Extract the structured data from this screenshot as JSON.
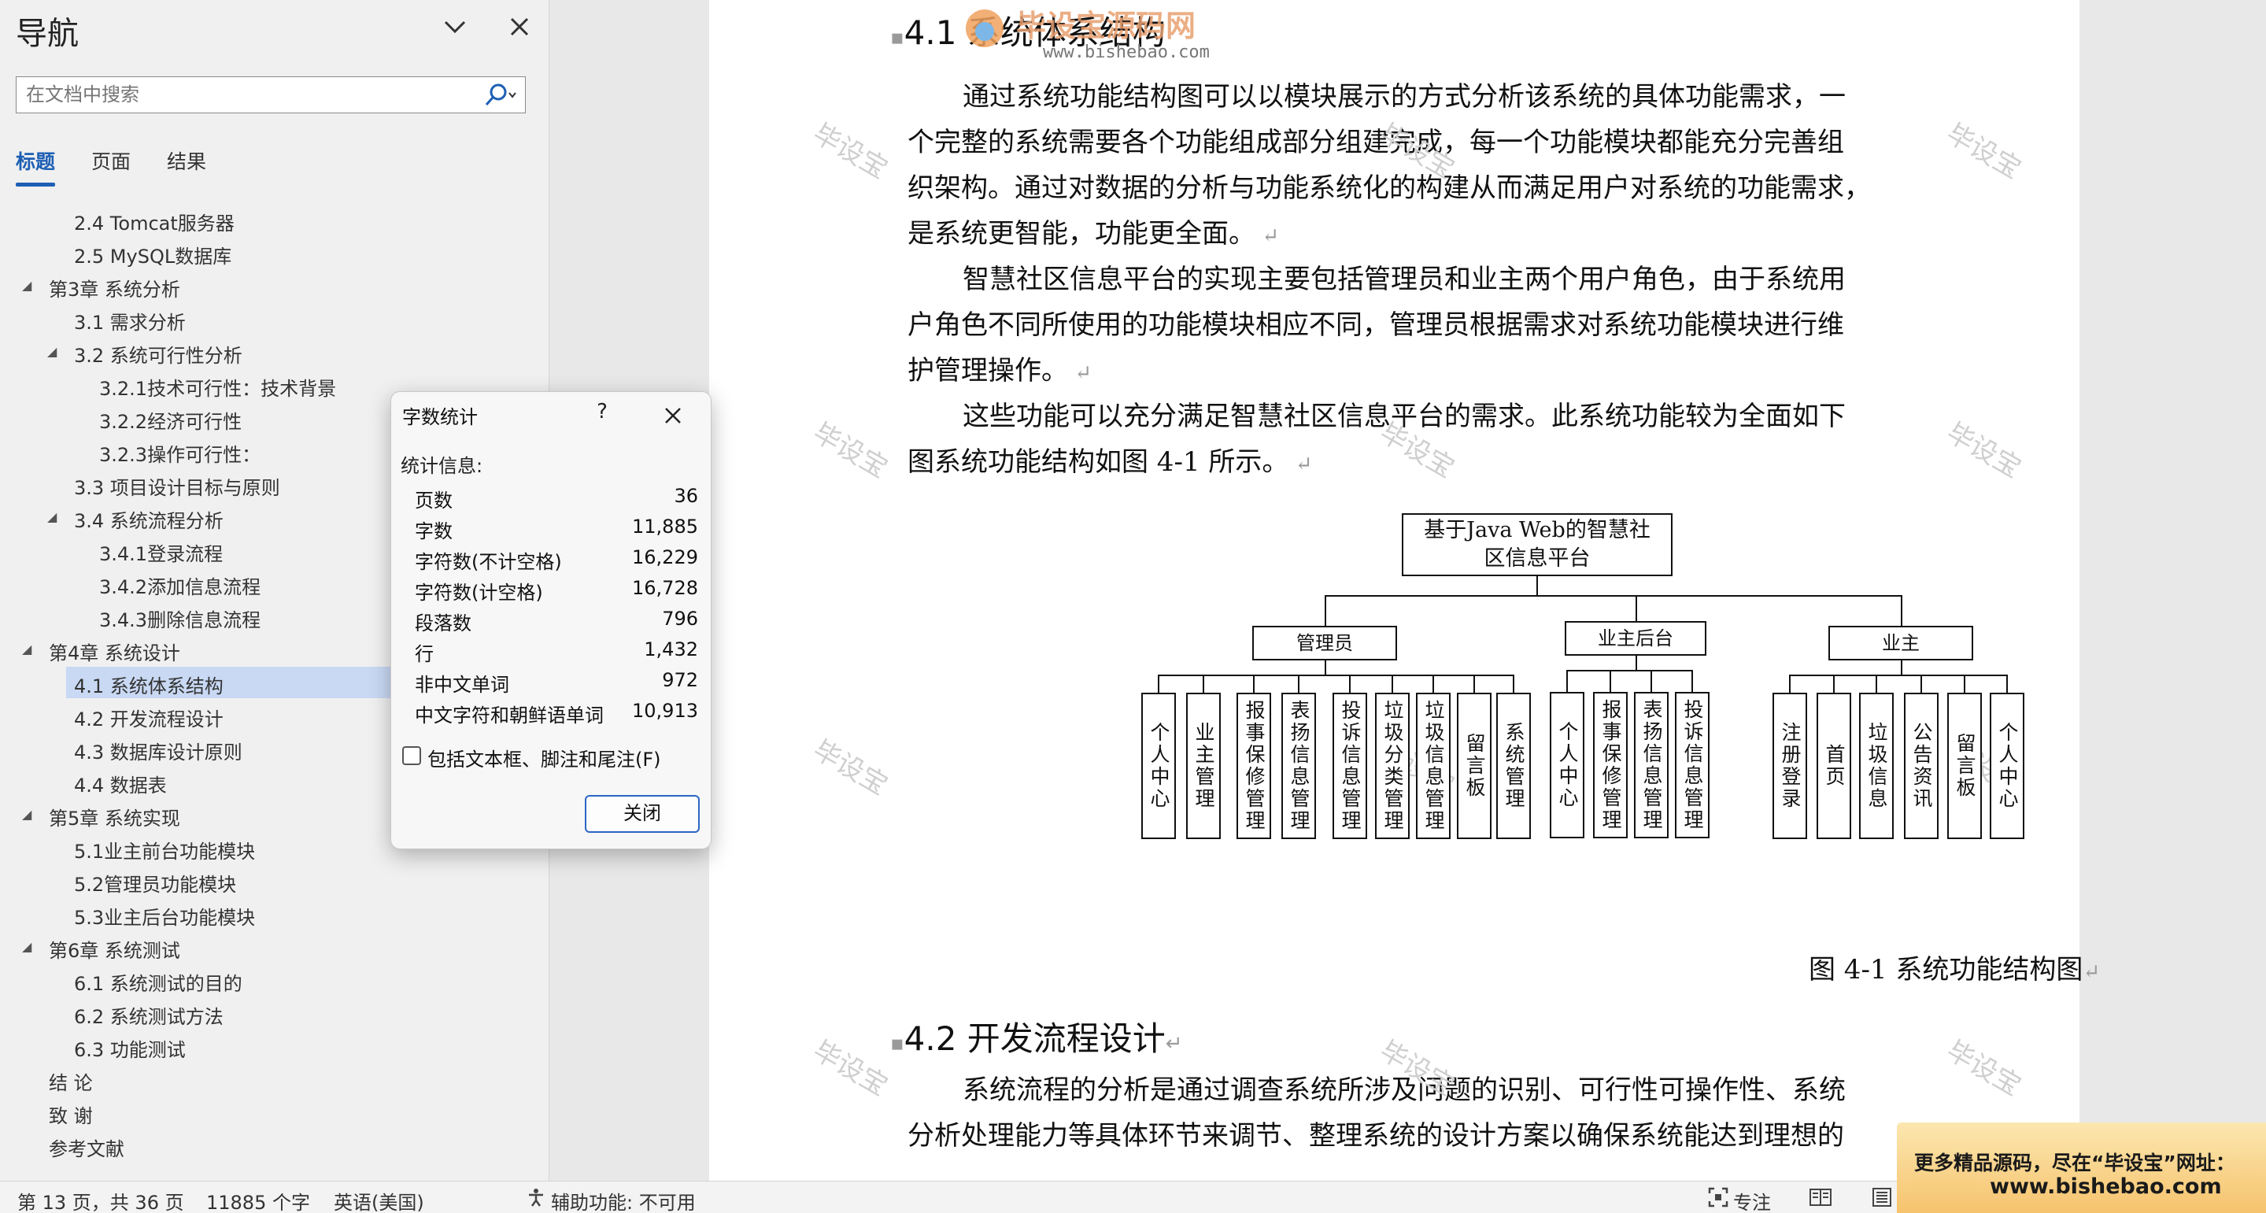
{
  "nav": {
    "title": "导航",
    "search_placeholder": "在文档中搜索",
    "tabs": [
      "标题",
      "页面",
      "结果"
    ],
    "items": [
      {
        "label": "2.4 Tomcat服务器",
        "level": 2,
        "toggle": false,
        "selected": false
      },
      {
        "label": "2.5 MySQL数据库",
        "level": 2,
        "toggle": false,
        "selected": false
      },
      {
        "label": "第3章 系统分析",
        "level": 1,
        "toggle": true,
        "selected": false
      },
      {
        "label": "3.1 需求分析",
        "level": 2,
        "toggle": false,
        "selected": false
      },
      {
        "label": "3.2 系统可行性分析",
        "level": 2,
        "toggle": true,
        "selected": false
      },
      {
        "label": "3.2.1技术可行性：技术背景",
        "level": 3,
        "toggle": false,
        "selected": false
      },
      {
        "label": "3.2.2经济可行性",
        "level": 3,
        "toggle": false,
        "selected": false
      },
      {
        "label": "3.2.3操作可行性：",
        "level": 3,
        "toggle": false,
        "selected": false
      },
      {
        "label": "3.3 项目设计目标与原则",
        "level": 2,
        "toggle": false,
        "selected": false
      },
      {
        "label": "3.4 系统流程分析",
        "level": 2,
        "toggle": true,
        "selected": false
      },
      {
        "label": "3.4.1登录流程",
        "level": 3,
        "toggle": false,
        "selected": false
      },
      {
        "label": "3.4.2添加信息流程",
        "level": 3,
        "toggle": false,
        "selected": false
      },
      {
        "label": "3.4.3删除信息流程",
        "level": 3,
        "toggle": false,
        "selected": false
      },
      {
        "label": "第4章 系统设计",
        "level": 1,
        "toggle": true,
        "selected": false
      },
      {
        "label": "4.1 系统体系结构",
        "level": 2,
        "toggle": false,
        "selected": true
      },
      {
        "label": "4.2 开发流程设计",
        "level": 2,
        "toggle": false,
        "selected": false
      },
      {
        "label": "4.3 数据库设计原则",
        "level": 2,
        "toggle": false,
        "selected": false
      },
      {
        "label": "4.4 数据表",
        "level": 2,
        "toggle": false,
        "selected": false
      },
      {
        "label": "第5章 系统实现",
        "level": 1,
        "toggle": true,
        "selected": false
      },
      {
        "label": "5.1业主前台功能模块",
        "level": 2,
        "toggle": false,
        "selected": false
      },
      {
        "label": "5.2管理员功能模块",
        "level": 2,
        "toggle": false,
        "selected": false
      },
      {
        "label": "5.3业主后台功能模块",
        "level": 2,
        "toggle": false,
        "selected": false
      },
      {
        "label": "第6章 系统测试",
        "level": 1,
        "toggle": true,
        "selected": false
      },
      {
        "label": "6.1 系统测试的目的",
        "level": 2,
        "toggle": false,
        "selected": false
      },
      {
        "label": "6.2 系统测试方法",
        "level": 2,
        "toggle": false,
        "selected": false
      },
      {
        "label": "6.3 功能测试",
        "level": 2,
        "toggle": false,
        "selected": false
      },
      {
        "label": "结 论",
        "level": 1,
        "toggle": false,
        "selected": false
      },
      {
        "label": "致 谢",
        "level": 1,
        "toggle": false,
        "selected": false
      },
      {
        "label": "参考文献",
        "level": 1,
        "toggle": false,
        "selected": false
      }
    ]
  },
  "document": {
    "heading_41": "4.1  系统体系结构",
    "para1": [
      "通过系统功能结构图可以以模块展示的方式分析该系统的具体功能需求，一",
      "个完整的系统需要各个功能组成部分组建完成，每一个功能模块都能充分完善组",
      "织架构。通过对数据的分析与功能系统化的构建从而满足用户对系统的功能需求，",
      "是系统更智能，功能更全面。"
    ],
    "para2": [
      "智慧社区信息平台的实现主要包括管理员和业主两个用户角色，由于系统用",
      "户角色不同所使用的功能模块相应不同，管理员根据需求对系统功能模块进行维",
      "护管理操作。"
    ],
    "para3": [
      "这些功能可以充分满足智慧社区信息平台的需求。此系统功能较为全面如下",
      "图系统功能结构如图 4-1 所示。"
    ],
    "diagram": {
      "root": [
        "基于Java Web的智慧社",
        "区信息平台"
      ],
      "groups": [
        {
          "name": "管理员",
          "children": [
            "个人中心",
            "业主管理",
            "报事保修管理",
            "表扬信息管理",
            "投诉信息管理",
            "垃圾分类管理",
            "垃圾信息管理",
            "留言板",
            "系统管理"
          ]
        },
        {
          "name": "业主后台",
          "children": [
            "个人中心",
            "报事保修管理",
            "表扬信息管理",
            "投诉信息管理"
          ]
        },
        {
          "name": "业主",
          "children": [
            "注册登录",
            "首页",
            "垃圾信息",
            "公告资讯",
            "留言板",
            "个人中心"
          ]
        }
      ]
    },
    "caption": "图 4-1 系统功能结构图",
    "heading_42": "4.2  开发流程设计",
    "para4": [
      "系统流程的分析是通过调查系统所涉及问题的识别、可行性可操作性、系统",
      "分析处理能力等具体环节来调节、整理系统的设计方案以确保系统能达到理想的"
    ],
    "watermark": "毕设宝",
    "logo_title": "毕设宝源码网",
    "logo_url": "www.bishebao.com"
  },
  "dialog": {
    "title": "字数统计",
    "help": "?",
    "stats_label": "统计信息:",
    "stats": [
      {
        "label": "页数",
        "value": "36"
      },
      {
        "label": "字数",
        "value": "11,885"
      },
      {
        "label": "字符数(不计空格)",
        "value": "16,229"
      },
      {
        "label": "字符数(计空格)",
        "value": "16,728"
      },
      {
        "label": "段落数",
        "value": "796"
      },
      {
        "label": "行",
        "value": "1,432"
      },
      {
        "label": "非中文单词",
        "value": "972"
      },
      {
        "label": "中文字符和朝鲜语单词",
        "value": "10,913"
      }
    ],
    "checkbox_label": "包括文本框、脚注和尾注(F)",
    "close_label": "关闭"
  },
  "status": {
    "page": "第 13 页，共 36 页",
    "words": "11885 个字",
    "language": "英语(美国)",
    "accessibility": "辅助功能: 不可用",
    "focus": "专注"
  },
  "ad": {
    "line1": "更多精品源码，尽在“毕设宝”网址：",
    "line2": "www.bishebao.com"
  }
}
